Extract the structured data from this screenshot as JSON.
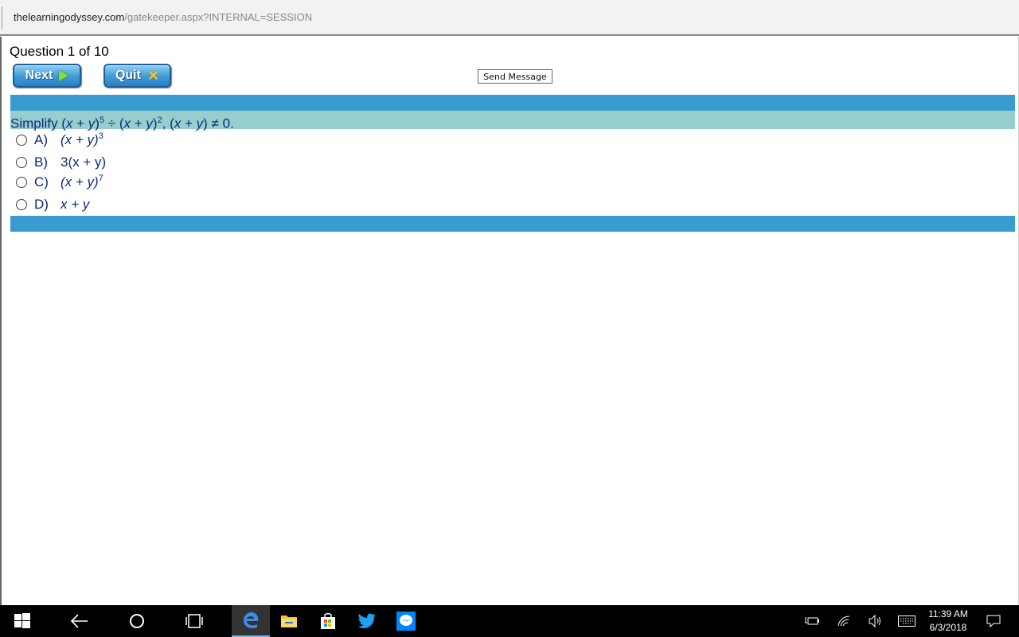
{
  "browser": {
    "url_host": "thelearningodyssey.com",
    "url_path": "/gatekeeper.aspx?INTERNAL=SESSION"
  },
  "quiz": {
    "counter": "Question 1 of 10",
    "next_label": "Next",
    "quit_label": "Quit",
    "send_message_label": "Send Message",
    "question": {
      "prefix": "Simplify (",
      "var_x": "x",
      "plus": " + ",
      "var_y": "y",
      "exp1": "5",
      "divide": " ÷ (",
      "exp2": "2",
      "condition_end": ") ≠ 0."
    },
    "options": [
      {
        "letter": "A)",
        "text": "(x + y)",
        "exp": "3"
      },
      {
        "letter": "B)",
        "text": "3(x + y)",
        "exp": ""
      },
      {
        "letter": "C)",
        "text": "(x + y)",
        "exp": "7"
      },
      {
        "letter": "D)",
        "text": "x + y",
        "exp": ""
      }
    ]
  },
  "taskbar": {
    "time": "11:39 AM",
    "date": "6/3/2018",
    "icons": [
      "windows-start-icon",
      "back-icon",
      "cortana-icon",
      "task-view-icon",
      "edge-icon",
      "file-explorer-icon",
      "store-icon",
      "twitter-icon",
      "messenger-icon"
    ],
    "tray_icons": [
      "battery-icon",
      "wifi-icon",
      "volume-icon",
      "keyboard-icon",
      "notifications-icon"
    ],
    "accent": "#6fb1f0"
  },
  "colors": {
    "bar_blue": "#3a9bd1",
    "question_bg": "#96cece",
    "question_text": "#0e2a7a"
  }
}
